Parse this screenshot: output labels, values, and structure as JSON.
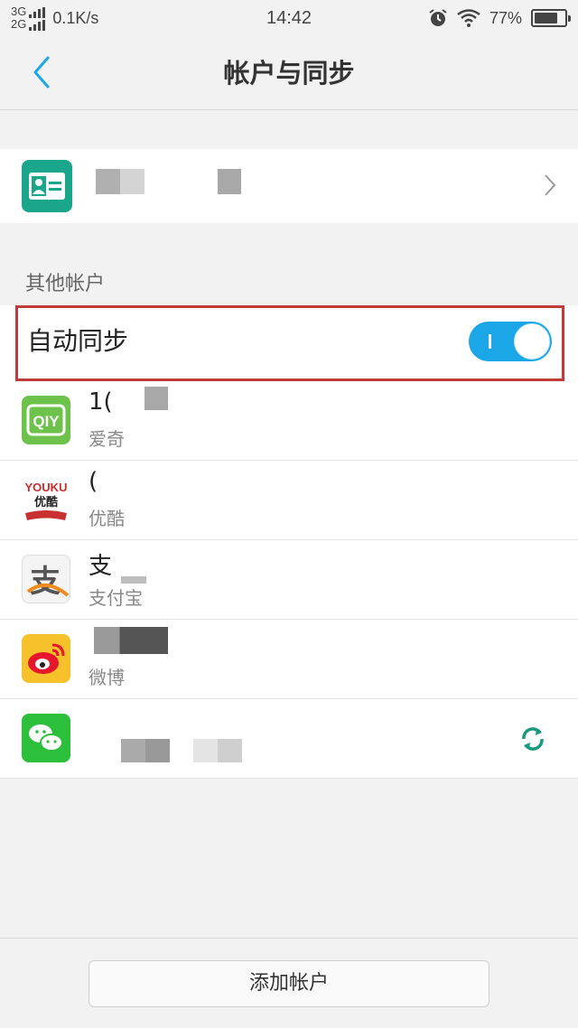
{
  "status_bar": {
    "network_top": "3G",
    "network_bottom": "2G",
    "speed": "0.1K/s",
    "time": "14:42",
    "battery": "77%",
    "battery_level": 0.77
  },
  "nav": {
    "title": "帐户与同步"
  },
  "section": {
    "other_accounts": "其他帐户"
  },
  "auto_sync": {
    "label": "自动同步",
    "enabled": true
  },
  "accounts": [
    {
      "name": "1(",
      "app": "爱奇",
      "icon": "iqiyi-icon"
    },
    {
      "name": "(",
      "app": "优酷",
      "icon": "youku-icon"
    },
    {
      "name": "支",
      "app": "支付宝",
      "icon": "alipay-icon"
    },
    {
      "name": "",
      "app": "微博",
      "icon": "weibo-icon"
    },
    {
      "name": "",
      "app": "",
      "icon": "wechat-icon"
    }
  ],
  "icons": {
    "iqiyi_text": "QIY",
    "youku_top": "YOUKU",
    "youku_bottom": "优酷",
    "alipay_char": "支"
  },
  "bottom": {
    "add_account": "添加帐户"
  },
  "colors": {
    "accent": "#1ba6e8",
    "highlight": "#c23a3a",
    "contacts": "#1aa68a",
    "sync": "#1a9a7a"
  }
}
